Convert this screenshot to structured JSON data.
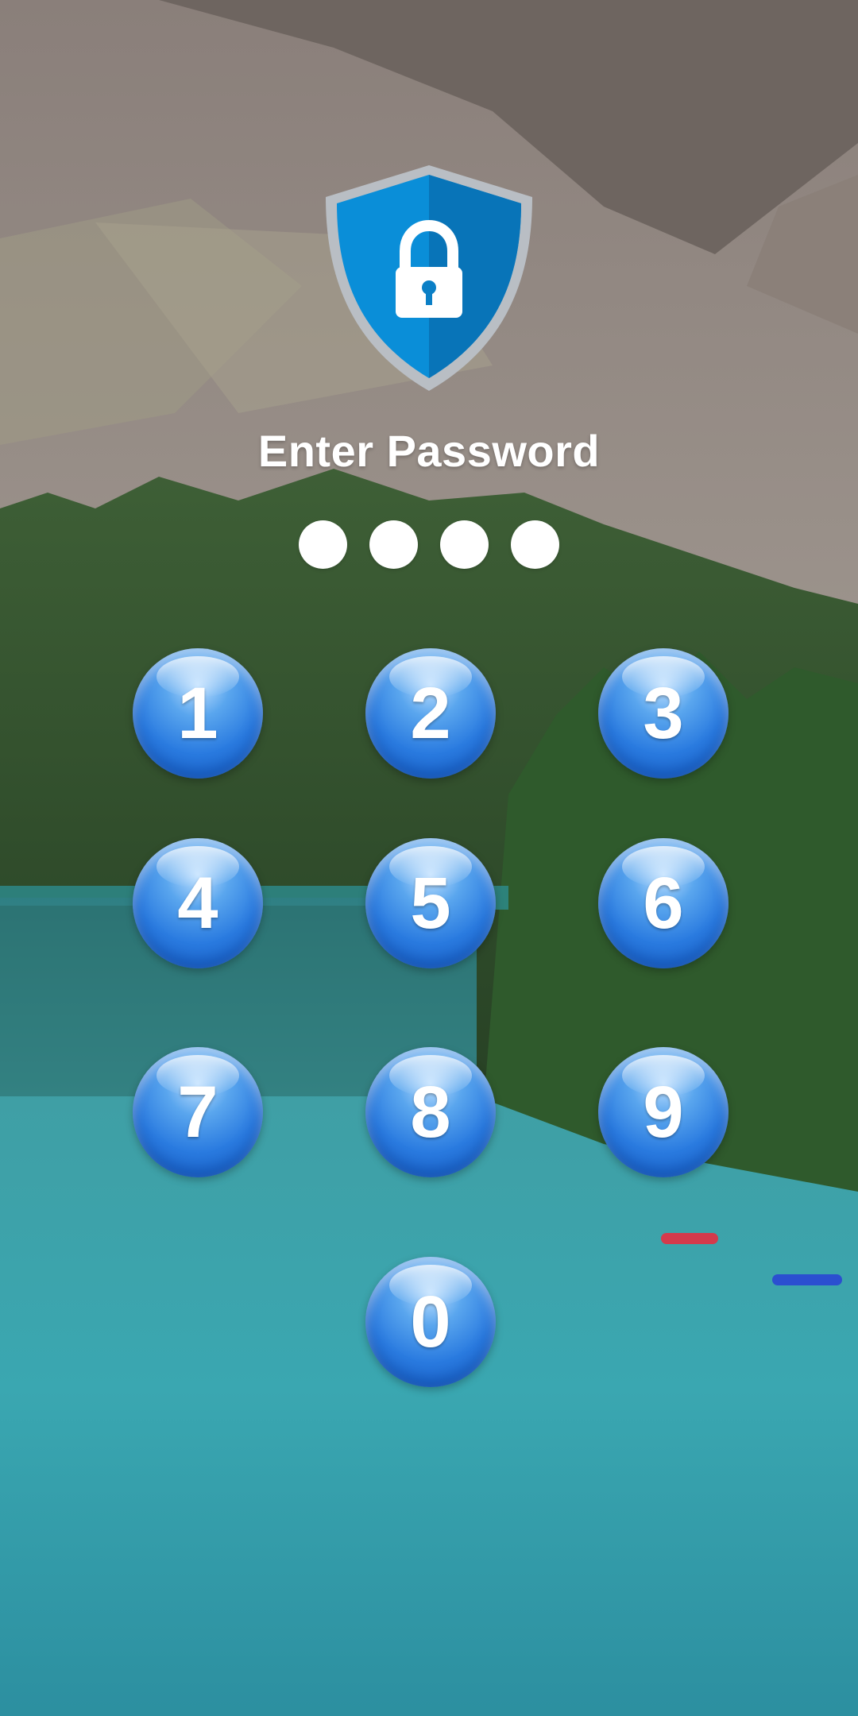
{
  "lock_screen": {
    "title": "Enter Password",
    "pin_length": 4,
    "entered_digits": 4
  },
  "keypad": {
    "keys": [
      "1",
      "2",
      "3",
      "4",
      "5",
      "6",
      "7",
      "8",
      "9",
      "0"
    ]
  },
  "colors": {
    "shield_light": "#0a8ed8",
    "shield_dark": "#0874b8",
    "key_blue": "#2a7be0",
    "water": "#3aa3aa"
  }
}
